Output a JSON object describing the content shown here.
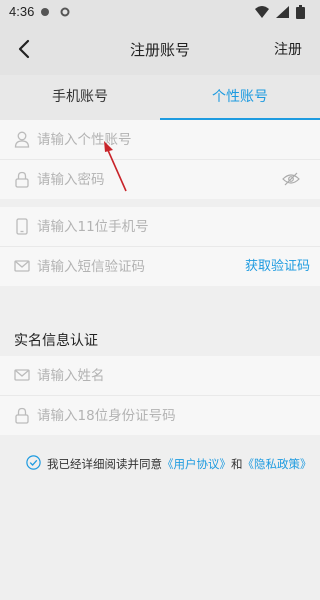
{
  "status_bar": {
    "time": "4:36"
  },
  "nav": {
    "title": "注册账号",
    "register_label": "注册"
  },
  "tabs": {
    "phone_label": "手机账号",
    "personal_label": "个性账号"
  },
  "personal_account": {
    "username_placeholder": "请输入个性账号",
    "password_placeholder": "请输入密码"
  },
  "phone_verify": {
    "phone_placeholder": "请输入11位手机号",
    "sms_placeholder": "请输入短信验证码",
    "get_code_label": "获取验证码"
  },
  "real_name": {
    "section_title": "实名信息认证",
    "name_placeholder": "请输入姓名",
    "id_placeholder": "请输入18位身份证号码"
  },
  "agreement": {
    "prefix": "我已经详细阅读并同意",
    "user_agreement": "《用户协议》",
    "and": "和",
    "privacy_policy": "《隐私政策》"
  },
  "colors": {
    "accent": "#1e9be0",
    "annotation": "#c8242a"
  }
}
